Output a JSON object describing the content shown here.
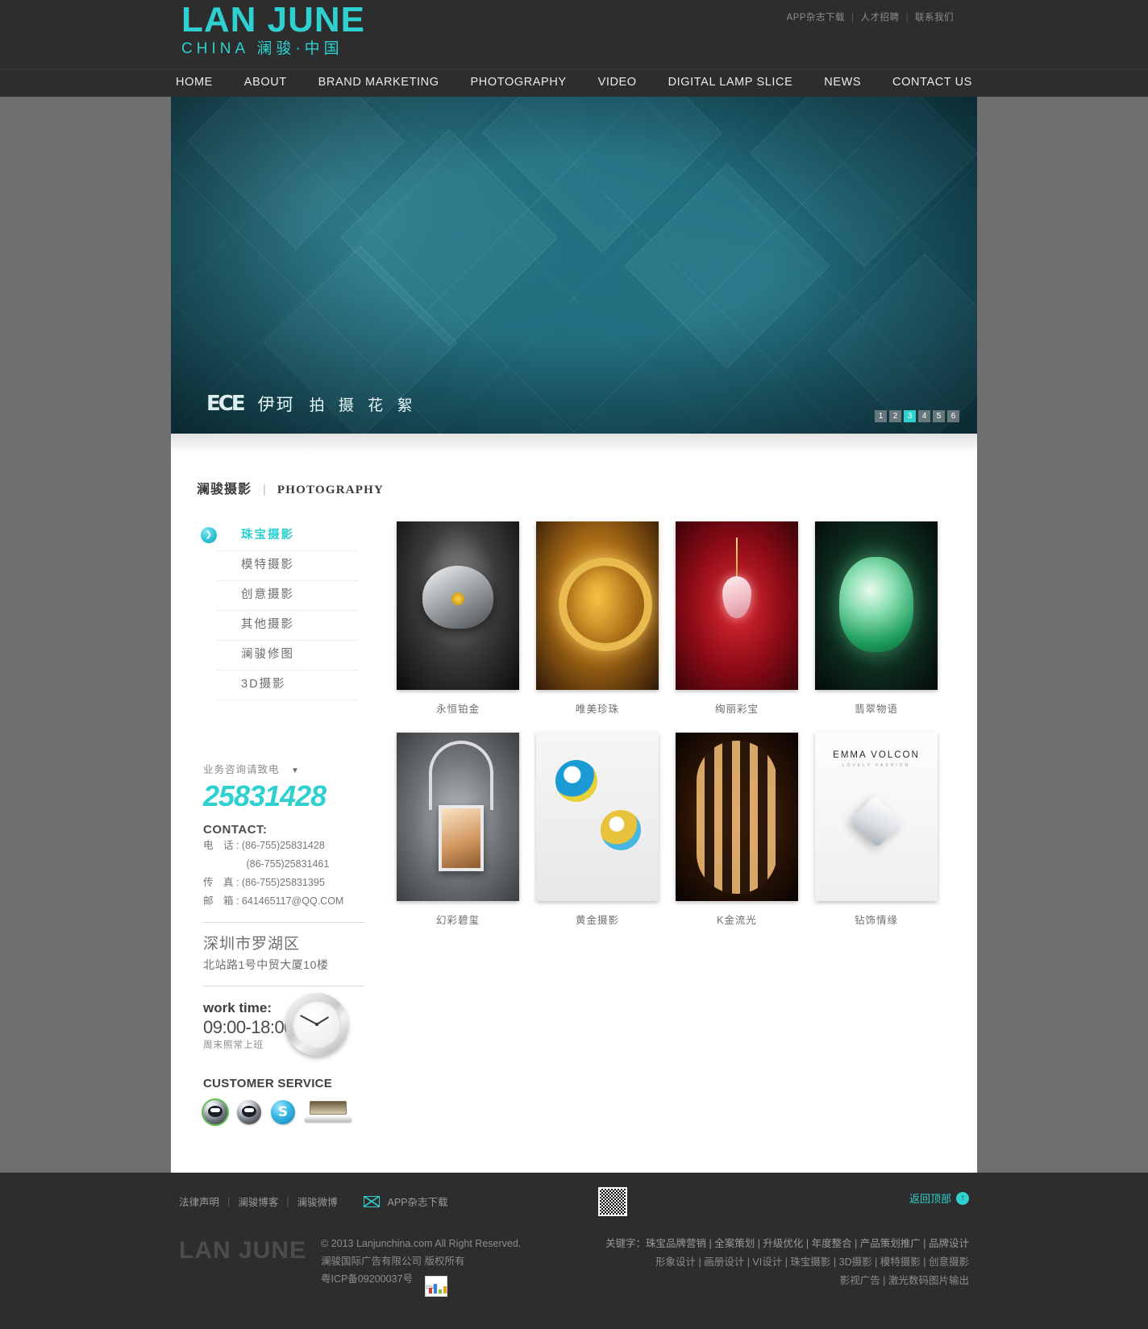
{
  "header": {
    "logo_main": "LAN JUNE",
    "logo_sub": "CHINA 澜骏·中国",
    "top_links": [
      "APP杂志下载",
      "人才招聘",
      "联系我们"
    ],
    "nav": [
      "HOME",
      "ABOUT",
      "BRAND MARKETING",
      "PHOTOGRAPHY",
      "VIDEO",
      "DIGITAL LAMP SLICE",
      "NEWS",
      "CONTACT US"
    ]
  },
  "banner": {
    "caption_logo": "ECE",
    "caption_cn": "伊珂",
    "caption_text": "拍 摄 花 絮",
    "slides": [
      "1",
      "2",
      "3",
      "4",
      "5",
      "6"
    ],
    "active_slide": "3"
  },
  "section": {
    "title_cn": "澜骏摄影",
    "title_divider": "|",
    "title_en": "PHOTOGRAPHY"
  },
  "sidebar": {
    "menu": [
      {
        "label": "珠宝摄影",
        "active": true
      },
      {
        "label": "模特摄影",
        "active": false
      },
      {
        "label": "创意摄影",
        "active": false
      },
      {
        "label": "其他摄影",
        "active": false
      },
      {
        "label": "澜骏修图",
        "active": false
      },
      {
        "label": "3D摄影",
        "active": false
      }
    ],
    "phone_label": "业务咨询请致电",
    "phone_caret": "▼",
    "phone_number": "25831428",
    "contact_head": "CONTACT:",
    "contact_lines": [
      "电　话 : (86-755)25831428",
      "　　　　 (86-755)25831461",
      "传　真 : (86-755)25831395",
      "邮　箱 : 641465117@QQ.COM"
    ],
    "address_line1": "深圳市罗湖区",
    "address_line2": "北站路1号中贸大厦10楼",
    "worktime_title": "work time:",
    "worktime_hours": "09:00-18:00",
    "worktime_note": "周末照常上班",
    "customer_service_title": "CUSTOMER SERVICE",
    "service_icons": [
      "qq-icon",
      "qq-icon",
      "skype-icon",
      "laptop-icon"
    ]
  },
  "gallery": {
    "items": [
      {
        "caption": "永恒铂金",
        "art": "t1"
      },
      {
        "caption": "唯美珍珠",
        "art": "t2"
      },
      {
        "caption": "绚丽彩宝",
        "art": "t3"
      },
      {
        "caption": "翡翠物语",
        "art": "t4"
      },
      {
        "caption": "幻彩碧玺",
        "art": "t5"
      },
      {
        "caption": "黄金摄影",
        "art": "t6"
      },
      {
        "caption": "K金流光",
        "art": "t7"
      },
      {
        "caption": "钻饰情缘",
        "art": "t8"
      }
    ],
    "brand_overlay_title": "EMMA VOLCON",
    "brand_overlay_sub": "LOVELY FASHION"
  },
  "footer": {
    "links": [
      "法律声明",
      "澜骏博客",
      "澜骏微博"
    ],
    "app_link": "APP杂志下载",
    "back_to_top": "返回顶部",
    "back_to_top_icon": "↑",
    "brand": "LAN JUNE",
    "copyright_line1": "© 2013 Lanjunchina.com All Right Reserved.",
    "copyright_line2": "澜骏国际广告有限公司 版权所有",
    "copyright_line3": "粤ICP备09200037号",
    "cnzz_label": "cnzz",
    "keywords_line1": "关键字：珠宝品牌营销 | 全案策划 | 升级优化 | 年度整合 | 产品策划推广 | 品牌设计",
    "keywords_line2": "形象设计 | 画册设计 | VI设计 | 珠宝摄影 | 3D摄影 | 模特摄影 | 创意摄影",
    "keywords_line3": "影视广告 | 激光数码图片输出"
  },
  "colors": {
    "accent": "#2ed0d0",
    "dark": "#2d2d2d",
    "page_bg": "#6f6f6f"
  }
}
